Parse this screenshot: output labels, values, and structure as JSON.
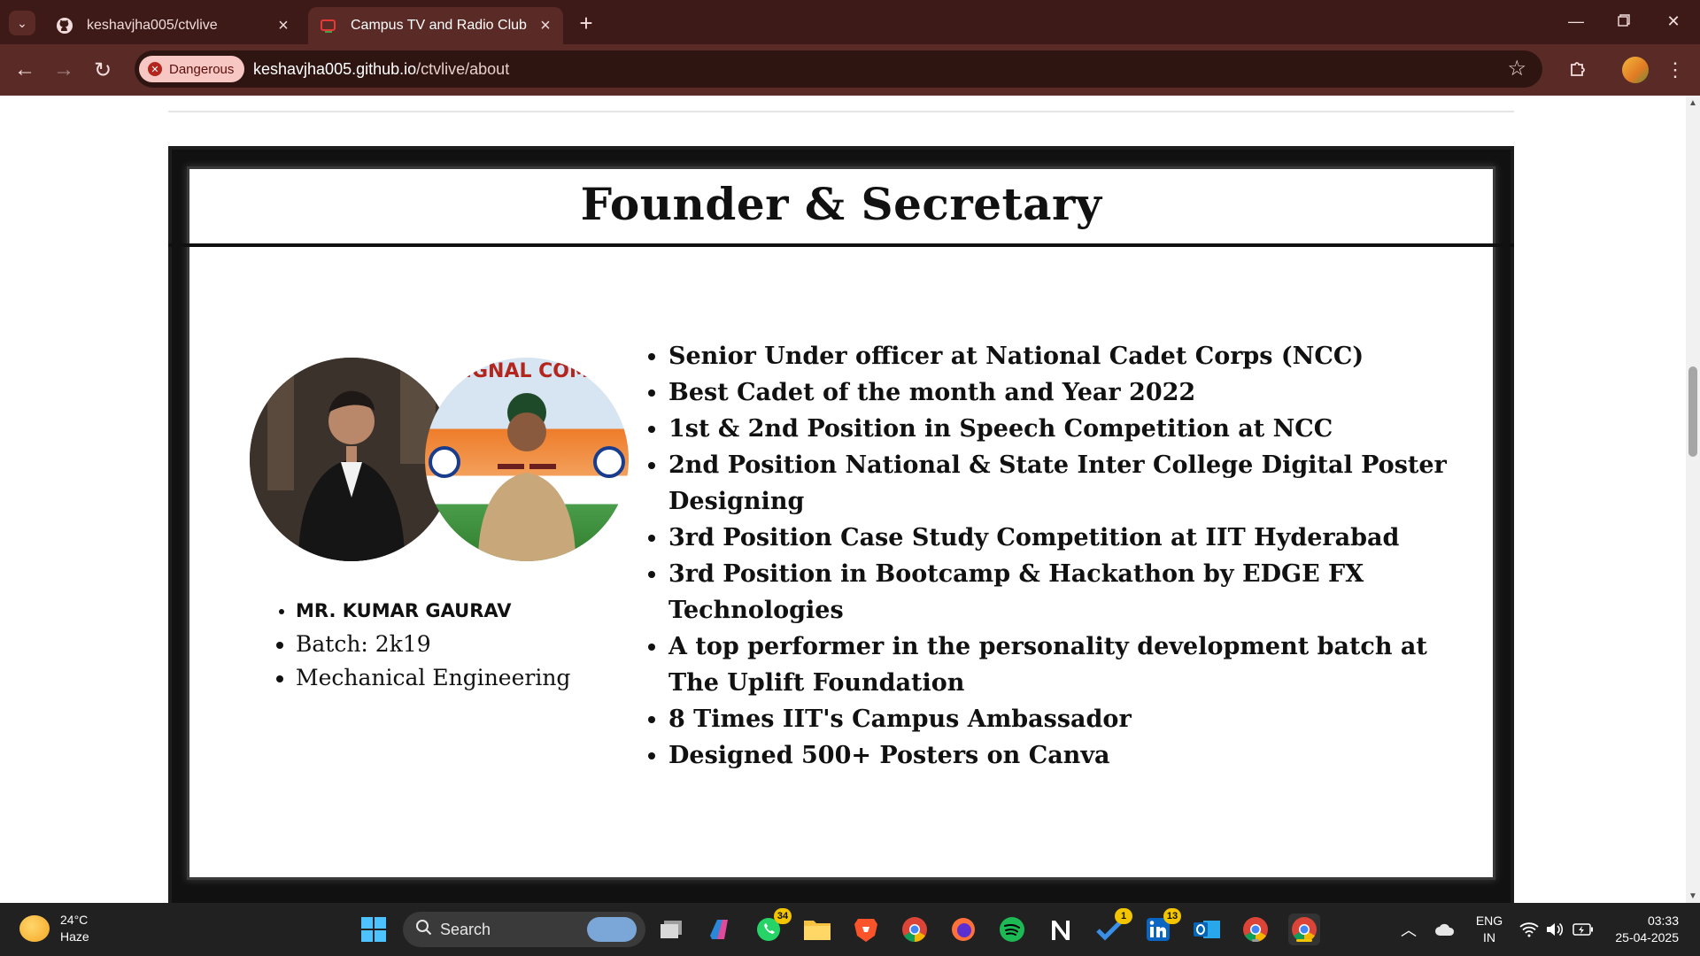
{
  "browser": {
    "tabs": [
      {
        "title": "keshavjha005/ctvlive",
        "icon": "github-icon"
      },
      {
        "title": "Campus TV and Radio Club",
        "icon": "tv-favicon-icon"
      }
    ],
    "security_chip": "Dangerous",
    "url_host": "keshavjha005.github.io",
    "url_path": "/ctvlive/about"
  },
  "page": {
    "section_title": "Founder & Secretary",
    "person": {
      "name": "MR. KUMAR GAURAV",
      "batch": "Batch: 2k19",
      "branch": "Mechanical Engineering"
    },
    "achievements": [
      "Senior Under officer at National Cadet Corps (NCC)",
      "Best Cadet of the month and Year 2022",
      "1st & 2nd Position in Speech Competition at NCC",
      "2nd Position National & State Inter College Digital Poster Designing",
      "3rd Position Case Study Competition at IIT Hyderabad",
      "3rd Position in Bootcamp & Hackathon by EDGE FX Technologies",
      "A top performer in the personality development batch at The Uplift Foundation",
      "8 Times IIT's Campus Ambassador",
      "Designed 500+ Posters on Canva"
    ],
    "photo_banner_text": "SIGNAL COMP"
  },
  "taskbar": {
    "weather_temp": "24°C",
    "weather_desc": "Haze",
    "search_label": "Search",
    "badges": {
      "whatsapp": "34",
      "todo": "1",
      "linkedin": "13"
    },
    "lang_line1": "ENG",
    "lang_line2": "IN",
    "time": "03:33",
    "date": "25-04-2025"
  },
  "colors": {
    "tabbar": "#3d1a17",
    "toolbar": "#5a2a26",
    "danger_chip": "#f7c7c3",
    "frame": "#111111",
    "taskbar": "#212121",
    "badge": "#f3c400"
  }
}
